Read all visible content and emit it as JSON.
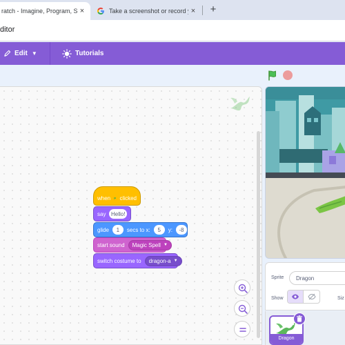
{
  "browser": {
    "tabs": [
      {
        "label": "ratch - Imagine, Program, Sh",
        "active": true
      },
      {
        "label": "Take a screenshot or record yo",
        "active": false
      }
    ],
    "new_tab_label": "+",
    "close_glyph": "×",
    "address": "ditor"
  },
  "menubar": {
    "edit_label": "Edit",
    "tutorials_label": "Tutorials"
  },
  "stage_controls": {
    "flag": "green-flag-icon",
    "stop": "stop-icon"
  },
  "script": {
    "hat": {
      "prefix": "when",
      "suffix": "clicked"
    },
    "say": {
      "label": "say",
      "message": "Hello!"
    },
    "glide": {
      "label_glide": "glide",
      "secs": "1",
      "label_secs": "secs to x:",
      "x": "5",
      "label_y": "y:",
      "y": "-8"
    },
    "sound": {
      "label": "start sound",
      "value": "Magic Spell"
    },
    "costume": {
      "label": "switch costume to",
      "value": "dragon-a"
    }
  },
  "sprite_info": {
    "sprite_label": "Sprite",
    "sprite_name": "Dragon",
    "show_label": "Show",
    "size_label": "Siz"
  },
  "sprite_list": [
    {
      "name": "Dragon",
      "selected": true
    }
  ],
  "colors": {
    "menu": "#855cd6",
    "events": "#ffbf00",
    "looks": "#9966ff",
    "motion": "#4c97ff",
    "sound": "#cf63cf"
  }
}
